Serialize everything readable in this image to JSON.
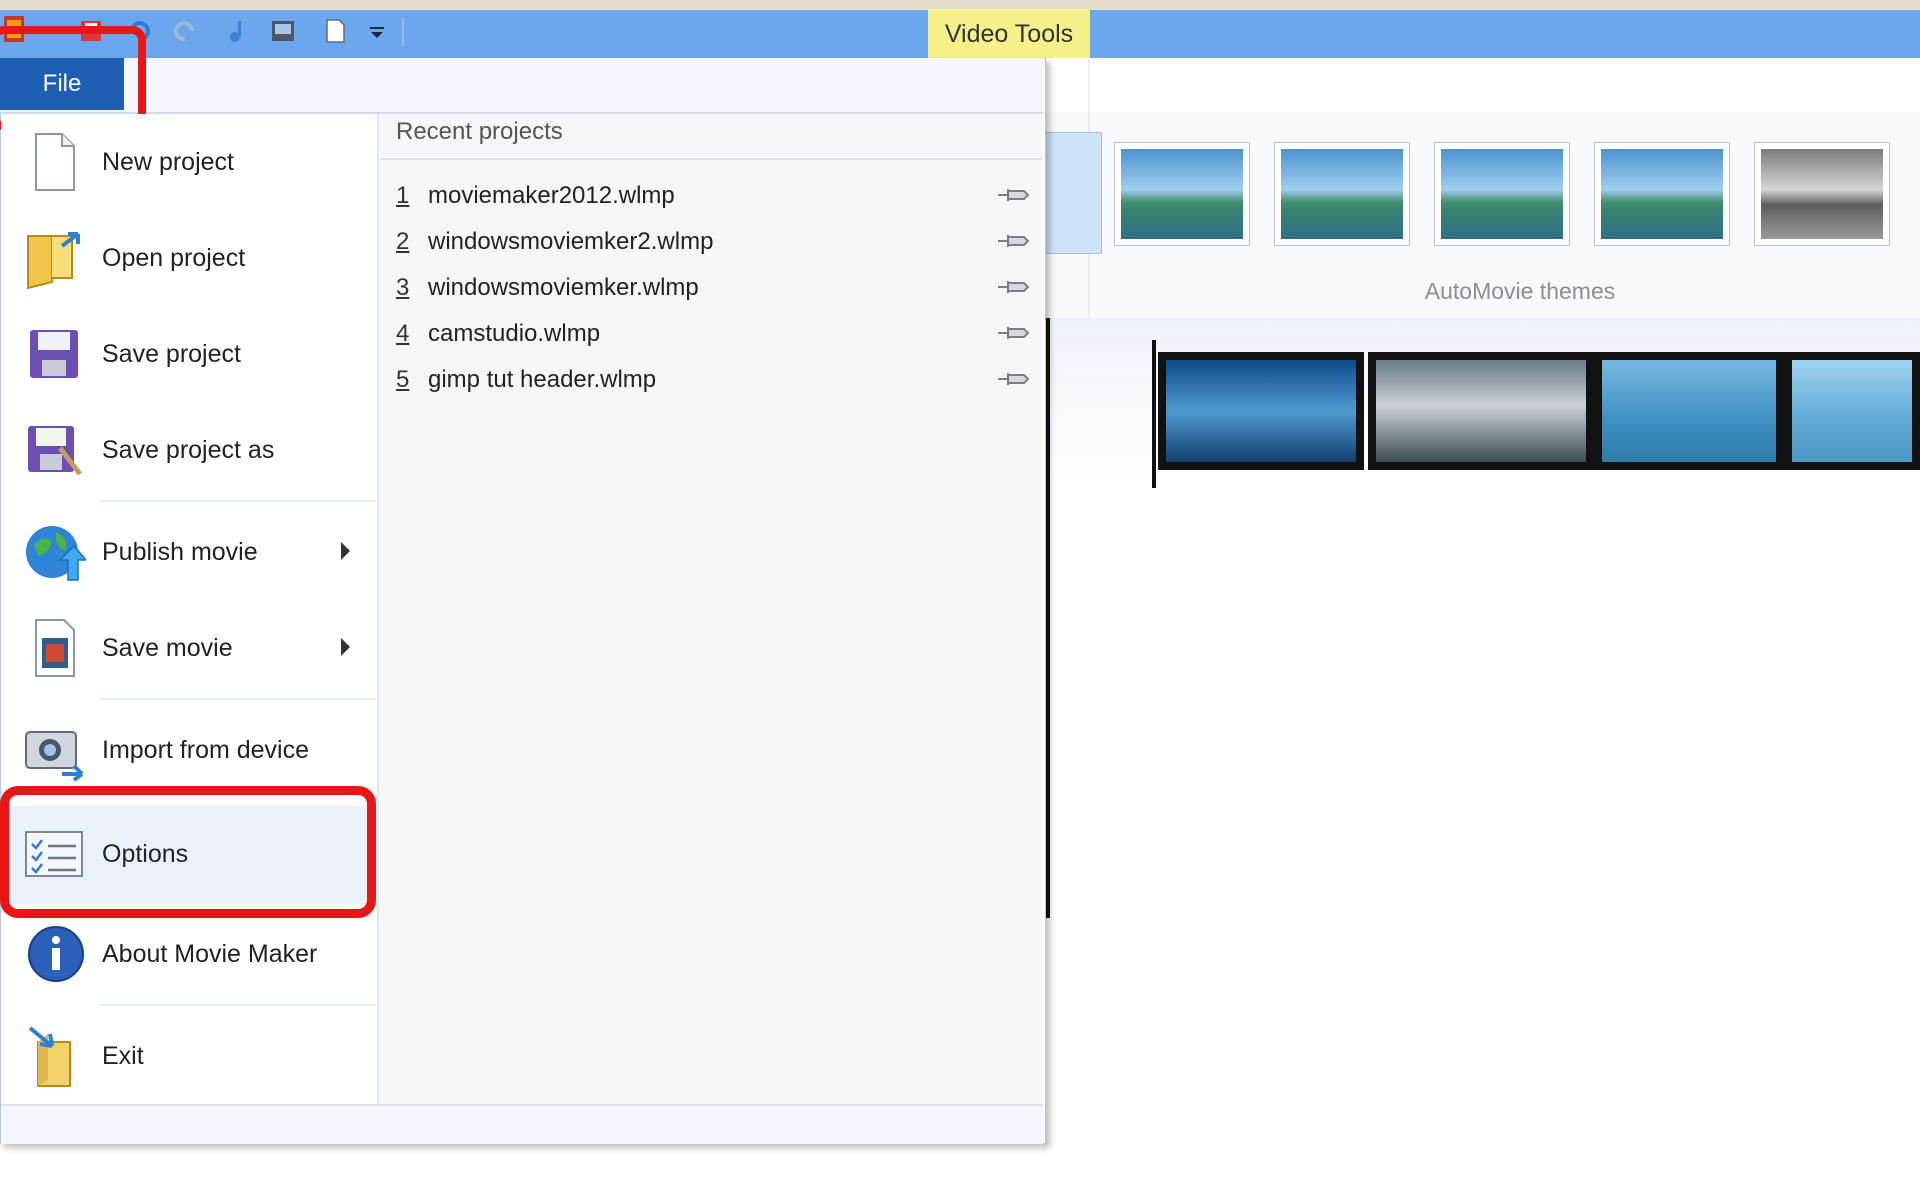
{
  "title_bar": {
    "contextual_tab": "Video Tools",
    "color": "#6ca7ee"
  },
  "file_menu": {
    "tab_label": "File",
    "items": [
      {
        "label": "New project",
        "icon": "new-document-icon"
      },
      {
        "label": "Open project",
        "icon": "open-folder-icon"
      },
      {
        "label": "Save project",
        "icon": "save-floppy-icon"
      },
      {
        "label": "Save project as",
        "icon": "save-as-icon"
      },
      {
        "label": "Publish movie",
        "icon": "globe-publish-icon",
        "has_submenu": true
      },
      {
        "label": "Save movie",
        "icon": "film-document-icon",
        "has_submenu": true
      },
      {
        "label": "Import from device",
        "icon": "camera-import-icon"
      },
      {
        "label": "Options",
        "icon": "options-checklist-icon"
      },
      {
        "label": "About Movie Maker",
        "icon": "info-icon"
      },
      {
        "label": "Exit",
        "icon": "exit-folder-icon"
      }
    ],
    "recent_header": "Recent projects",
    "recent": [
      {
        "num": "1",
        "name": "moviemaker2012.wlmp"
      },
      {
        "num": "2",
        "name": "windowsmoviemker2.wlmp"
      },
      {
        "num": "3",
        "name": "windowsmoviemker.wlmp"
      },
      {
        "num": "4",
        "name": "camstudio.wlmp"
      },
      {
        "num": "5",
        "name": "gimp tut header.wlmp"
      }
    ]
  },
  "ribbon": {
    "group_label": "AutoMovie themes"
  },
  "colors": {
    "highlight_red": "#e81616",
    "file_tab_blue": "#1f5fb3"
  }
}
